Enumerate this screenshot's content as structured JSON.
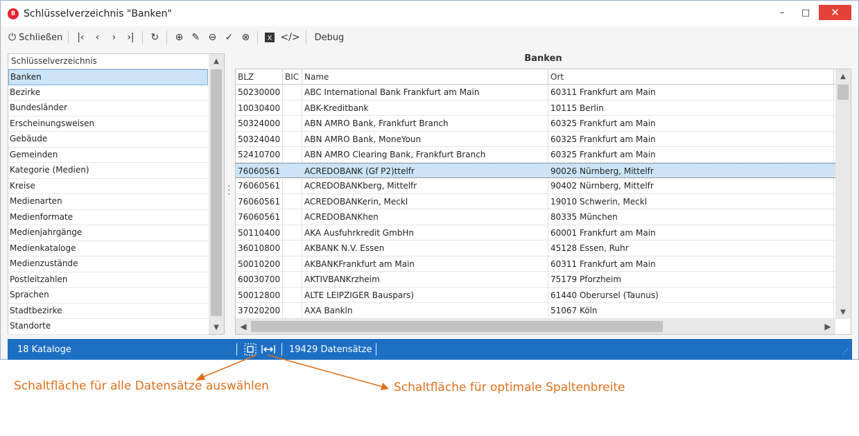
{
  "window": {
    "title": "Schlüsselverzeichnis \"Banken\"",
    "app_icon": "circle-logo-icon",
    "minimize": "–",
    "maximize": "□",
    "close": "✕"
  },
  "toolbar": {
    "close_label": "Schließen",
    "debug_label": "Debug"
  },
  "left": {
    "header": "Schlüsselverzeichnis",
    "items": [
      "Banken",
      "Bezirke",
      "Bundesländer",
      "Erscheinungsweisen",
      "Gebäude",
      "Gemeinden",
      "Kategorie (Medien)",
      "Kreise",
      "Medienarten",
      "Medienformate",
      "Medienjahrgänge",
      "Medienkataloge",
      "Medienzustände",
      "Postleitzahlen",
      "Sprachen",
      "Stadtbezirke",
      "Standorte"
    ],
    "selected_index": 0
  },
  "grid": {
    "title": "Banken",
    "columns": [
      "BLZ",
      "BIC",
      "Name",
      "Ort"
    ],
    "rows": [
      [
        "50230000",
        "",
        "ABC International Bank Frankfurt am Main",
        "60311 Frankfurt am Main"
      ],
      [
        "10030400",
        "",
        "ABK-Kreditbank",
        "10115 Berlin"
      ],
      [
        "50324000",
        "",
        "ABN AMRO Bank, Frankfurt Branch",
        "60325 Frankfurt am Main"
      ],
      [
        "50324040",
        "",
        "ABN AMRO Bank, MoneYoun",
        "60325 Frankfurt am Main"
      ],
      [
        "52410700",
        "",
        "ABN AMRO Clearing Bank, Frankfurt Branch",
        "60325 Frankfurt am Main"
      ],
      [
        "76060561",
        "",
        "ACREDOBANK (Gf P2)ttelfr",
        "90026 Nürnberg, Mittelfr"
      ],
      [
        "76060561",
        "",
        "ACREDOBANKberg, Mittelfr",
        "90402 Nürnberg, Mittelfr"
      ],
      [
        "76060561",
        "",
        "ACREDOBANKerin, Meckl",
        "19010 Schwerin, Meckl"
      ],
      [
        "76060561",
        "",
        "ACREDOBANKhen",
        "80335 München"
      ],
      [
        "50110400",
        "",
        "AKA Ausfuhrkredit GmbHn",
        "60001 Frankfurt am Main"
      ],
      [
        "36010800",
        "",
        "AKBANK N.V. Essen",
        "45128 Essen, Ruhr"
      ],
      [
        "50010200",
        "",
        "AKBANKFrankfurt am Main",
        "60311 Frankfurt am Main"
      ],
      [
        "60030700",
        "",
        "AKTIVBANKrzheim",
        "75179 Pforzheim"
      ],
      [
        "50012800",
        "",
        "ALTE LEIPZIGER Bauspars)",
        "61440 Oberursel (Taunus)"
      ],
      [
        "37020200",
        "",
        "AXA Bankln",
        "51067 Köln"
      ]
    ],
    "selected_index": 5
  },
  "status": {
    "catalog_count": "18 Kataloge",
    "record_count": "19429 Datensätze"
  },
  "annotations": {
    "select_all": "Schaltfläche für alle Datensätze auswählen",
    "optimal_width": "Schaltfläche für optimale Spaltenbreite"
  }
}
